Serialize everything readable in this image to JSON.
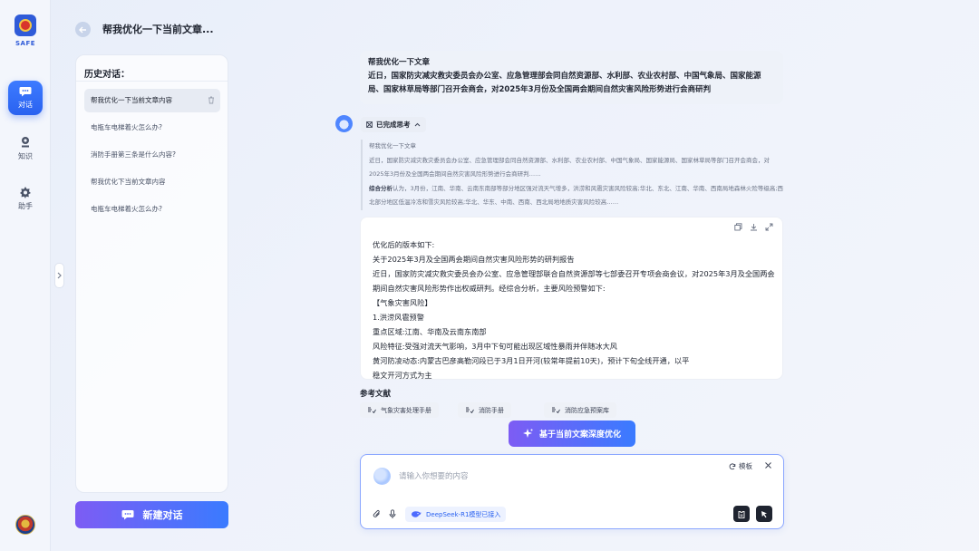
{
  "rail": {
    "brand": "SAFE",
    "items": [
      {
        "label": "对话",
        "icon": "chat-icon"
      },
      {
        "label": "知识",
        "icon": "knowledge-icon"
      },
      {
        "label": "助手",
        "icon": "assistant-icon"
      }
    ]
  },
  "header": {
    "title": "帮我优化一下当前文章..."
  },
  "history": {
    "title": "历史对话：",
    "items": [
      "帮我优化一下当前文章内容",
      "电瓶车电梯着火怎么办?",
      "消防手册第三条是什么内容?",
      "帮我优化下当前文章内容",
      "电瓶车电梯着火怎么办?"
    ]
  },
  "new_chat_label": "新建对话",
  "user_message": {
    "line1": "帮我优化一下文章",
    "line2": "近日，国家防灾减灾救灾委员会办公室、应急管理部会同自然资源部、水利部、农业农村部、中国气象局、国家能源局、国家林草局等部门召开会商会，对2025年3月份及全国两会期间自然灾害风险形势进行会商研判"
  },
  "thinking": {
    "status": "已完成思考",
    "line1": "帮我优化一下文章",
    "line2": "近日，国家防灾减灾救灾委员会办公室、应急管理部会同自然资源部、水利部、农业农村部、中国气象局、国家能源局、国家林草局等部门召开会商会，对2025年3月份及全国两会期间自然灾害风险形势进行会商研判……",
    "analysis_label": "综合分析",
    "analysis_text": "认为，3月份，江南、华南、云南东南部等部分地区强对流天气增多，洪涝和风雹灾害风险较高;华北、东北、江南、华南、西南局地森林火险等级高;西北部分地区低温冷冻和雪灾风险较高;华北、华东、中南、西南、西北局地地质灾害风险较高……"
  },
  "answer": {
    "lines": [
      "优化后的版本如下:",
      "关于2025年3月及全国两会期间自然灾害风险形势的研判报告",
      "近日，国家防灾减灾救灾委员会办公室、应急管理部联合自然资源部等七部委召开专项会商会议，对2025年3月及全国两会期间自然灾害风险形势作出权威研判。经综合分析，主要风险预警如下:",
      "【气象灾害风险】",
      "1.洪涝风雹预警",
      "重点区域:江南、华南及云南东南部",
      "风险特征:受强对流天气影响，3月中下旬可能出现区域性暴雨并伴随冰大风",
      "黄河防凌动态:内蒙古巴彦高勒河段已于3月1日开河(较常年提前10天)，预计下旬全线开通，以平",
      "稳文开河方式为主"
    ]
  },
  "references": {
    "title": "参考文献",
    "items": [
      "气象灾害处理手册",
      "消防手册",
      "消防应急预案库"
    ]
  },
  "deep_optimize_label": "基于当前文案深度优化",
  "composer": {
    "placeholder": "请输入你想要的内容",
    "template_label": "模板",
    "model_badge": "DeepSeek-R1模型已接入"
  }
}
